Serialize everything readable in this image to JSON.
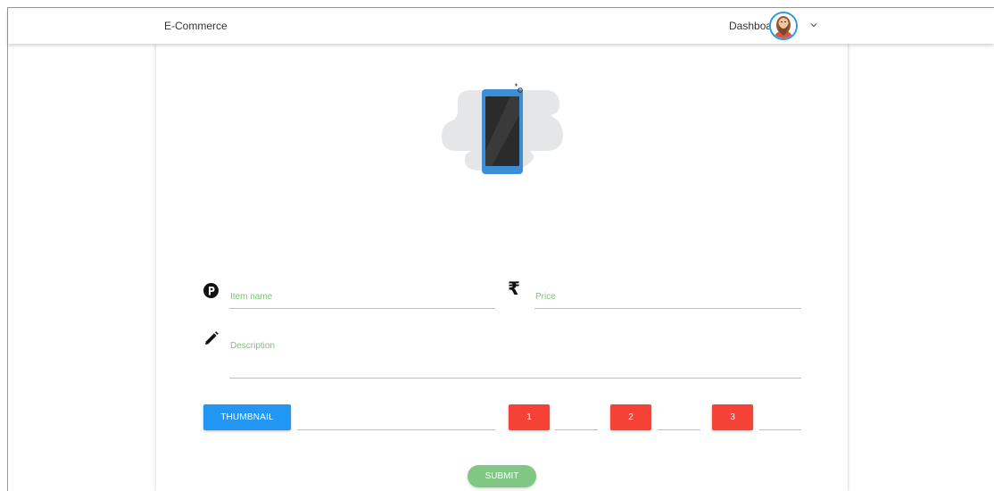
{
  "navbar": {
    "brand": "E-Commerce",
    "dashboard_link": "Dashboard"
  },
  "form": {
    "item_name_placeholder": "Item name",
    "price_placeholder": "Price",
    "description_placeholder": "Description",
    "currency_symbol": "₹",
    "thumbnail_button": "THUMBNAIL",
    "image_buttons": [
      "1",
      "2",
      "3"
    ],
    "submit_button": "SUBMIT"
  },
  "colors": {
    "primary_blue": "#2196f3",
    "danger_red": "#f44336",
    "submit_green": "#81c784",
    "label_green": "#7ac47c"
  }
}
